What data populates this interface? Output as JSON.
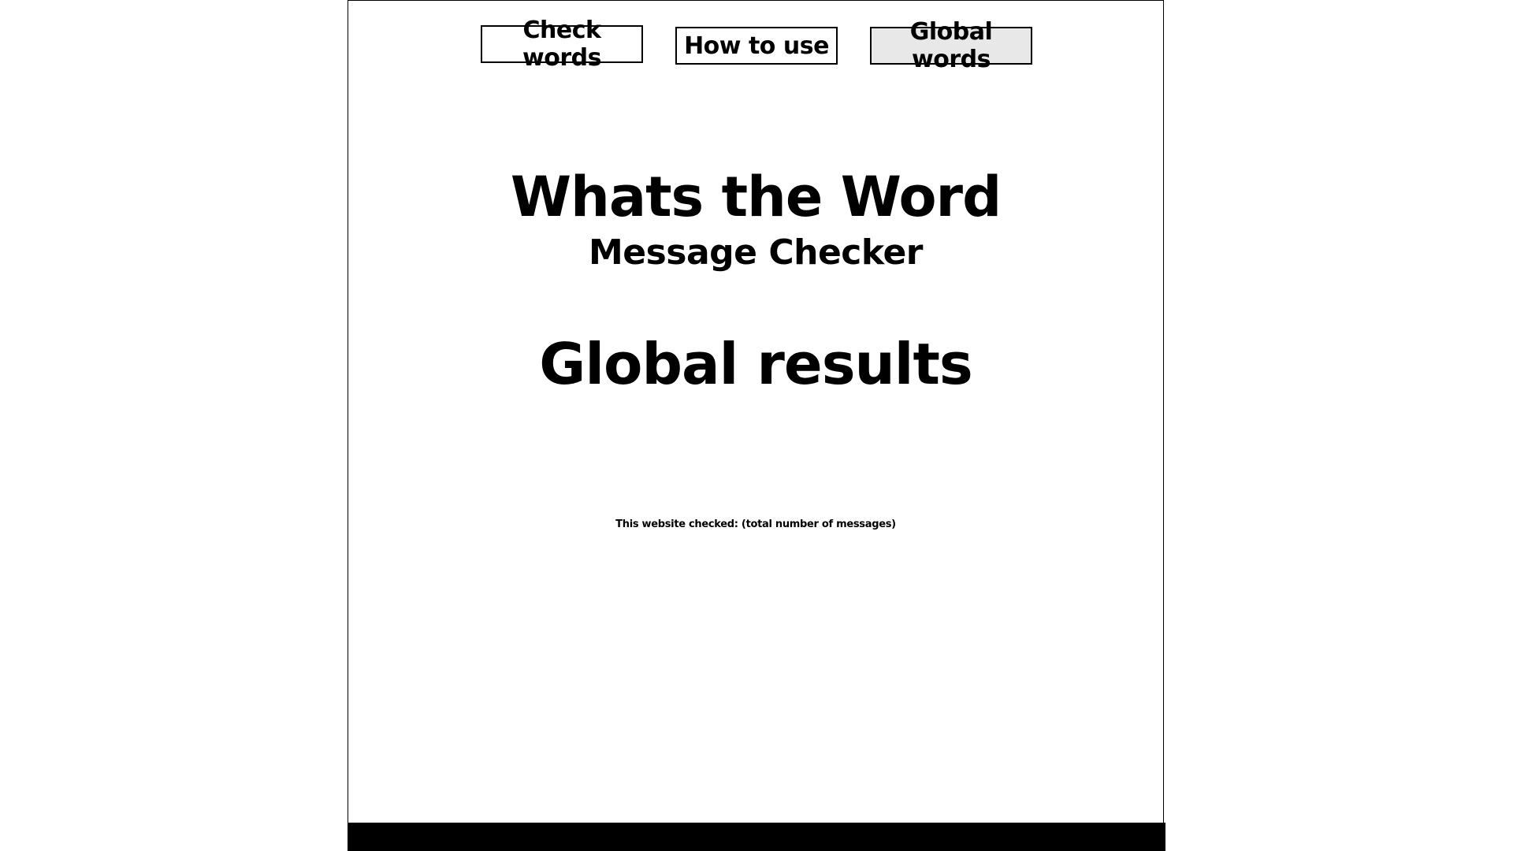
{
  "nav": {
    "items": [
      {
        "label": "Check words",
        "active": false
      },
      {
        "label": "How to use",
        "active": false
      },
      {
        "label": "Global words",
        "active": true
      }
    ]
  },
  "header": {
    "title": "Whats the Word",
    "subtitle": "Message Checker"
  },
  "main": {
    "heading": "Global results",
    "stats_text": "This website checked: (total number of messages)"
  },
  "colors": {
    "background": "#ffffff",
    "text": "#000000",
    "active_button_bg": "#e8e8e8",
    "footer": "#000000"
  }
}
